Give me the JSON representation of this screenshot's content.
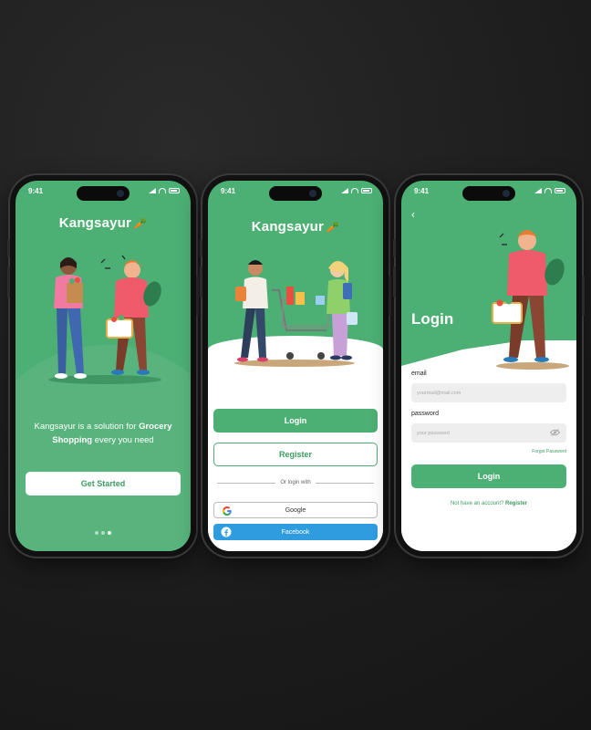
{
  "status_time": "9:41",
  "brand": "Kangsayur",
  "colors": {
    "primary": "#4caf73",
    "text_green": "#3d9b63",
    "facebook": "#2f9ce0",
    "background": "#1c1c1c"
  },
  "onboarding": {
    "text_plain_1": "Kangsayur is a solution for ",
    "text_bold_1": "Grocery",
    "text_bold_2": "Shopping",
    "text_plain_2": " every you need",
    "cta_label": "Get Started",
    "pager": {
      "count": 3,
      "active_index": 2
    }
  },
  "welcome": {
    "login_label": "Login",
    "register_label": "Register",
    "divider_label": "Or login with",
    "google_label": "Google",
    "facebook_label": "Facebook"
  },
  "login": {
    "title": "Login",
    "email_label": "email",
    "email_placeholder": "yourmail@mail.com",
    "password_label": "password",
    "password_placeholder": "your password",
    "forgot_label": "Forgot Password",
    "submit_label": "Login",
    "register_prompt": "Not have an account?",
    "register_link": "Register"
  },
  "icons": {
    "brand_mark": "carrot-leaf-icon",
    "back": "chevron-left-icon",
    "password_toggle": "eye-off-icon",
    "google": "google-icon",
    "facebook": "facebook-icon"
  }
}
